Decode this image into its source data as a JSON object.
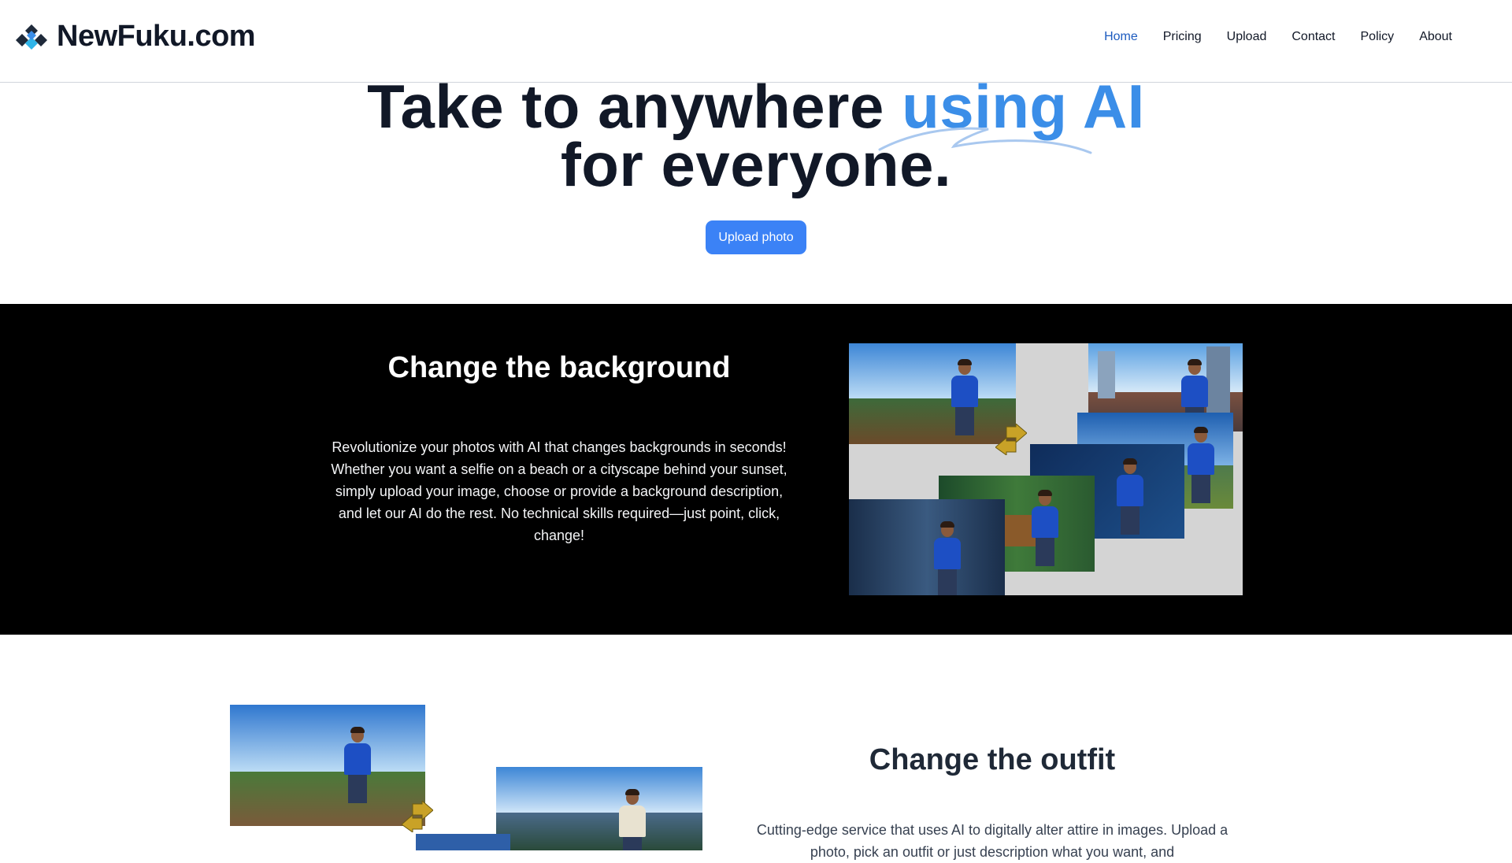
{
  "header": {
    "logo_text": "NewFuku.com",
    "nav": [
      {
        "label": "Home",
        "active": true
      },
      {
        "label": "Pricing",
        "active": false
      },
      {
        "label": "Upload",
        "active": false
      },
      {
        "label": "Contact",
        "active": false
      },
      {
        "label": "Policy",
        "active": false
      },
      {
        "label": "About",
        "active": false
      }
    ]
  },
  "hero": {
    "title_part1": "Take to anywhere ",
    "title_accent": "using AI",
    "title_line2": "for everyone.",
    "cta_label": "Upload photo"
  },
  "background_section": {
    "title": "Change the background",
    "description": "Revolutionize your photos with AI that changes backgrounds in seconds! Whether you want a selfie on a beach or a cityscape behind your sunset, simply upload your image, choose or provide a background description, and let our AI do the rest. No technical skills required—just point, click, change!"
  },
  "outfit_section": {
    "title": "Change the outfit",
    "description": "Cutting-edge service that uses AI to digitally alter attire in images. Upload a photo, pick an outfit or just description what you want, and"
  },
  "colors": {
    "accent": "#3b8ee8",
    "button": "#3b82f6",
    "nav_active": "#1d5bbf",
    "band_bg": "#000000"
  }
}
